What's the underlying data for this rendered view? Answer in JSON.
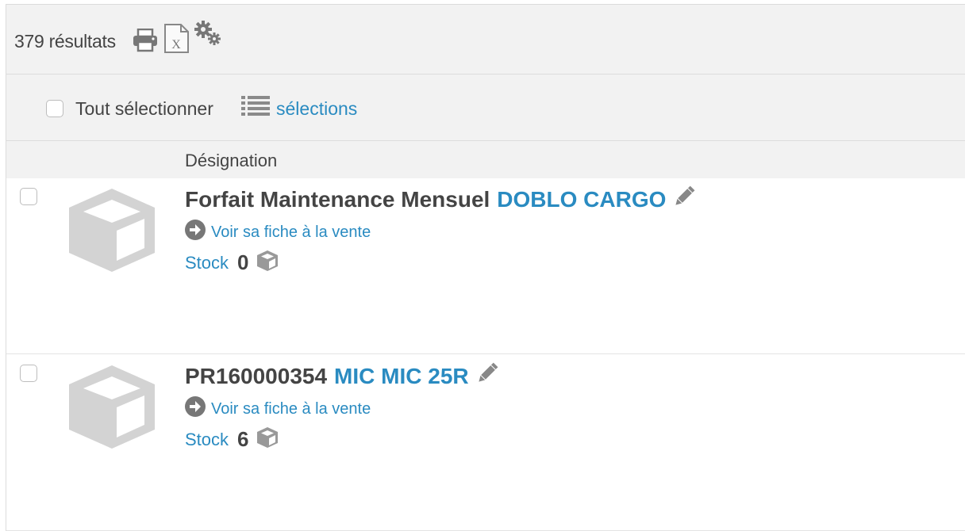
{
  "toolbar": {
    "results_count": "379 résultats",
    "print_icon": "print-icon",
    "excel_icon": "excel-export-icon",
    "settings_icon": "gears-icon"
  },
  "selection": {
    "select_all_label": "Tout sélectionner",
    "list_icon": "list-icon",
    "selections_link": "sélections"
  },
  "table": {
    "header": "Désignation"
  },
  "products": [
    {
      "name": "Forfait Maintenance Mensuel",
      "model": "DOBLO CARGO",
      "sale_link": "Voir sa fiche à la vente",
      "stock_label": "Stock",
      "stock_value": "0"
    },
    {
      "name": "PR160000354",
      "model": "MIC MIC 25R",
      "sale_link": "Voir sa fiche à la vente",
      "stock_label": "Stock",
      "stock_value": "6"
    }
  ],
  "colors": {
    "link": "#2a8bc1",
    "text": "#444444",
    "toolbar_bg": "#f2f2f2",
    "icon_gray": "#888888",
    "placeholder_gray": "#d3d3d3"
  }
}
